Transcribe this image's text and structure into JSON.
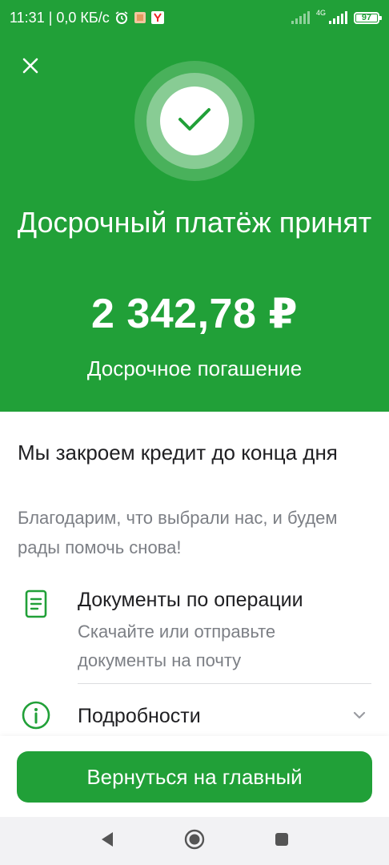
{
  "status_bar": {
    "time_speed": "11:31 | 0,0 КБ/с",
    "network": "4G",
    "battery": "97",
    "icons": [
      "alarm-icon",
      "app-notification-icon",
      "yandex-icon",
      "signal-icon",
      "battery-icon"
    ]
  },
  "hero": {
    "close_icon": "close-icon",
    "status_icon": "checkmark-icon",
    "title": "Досрочный платёж принят",
    "amount": "2 342,78 ₽",
    "subtitle": "Досрочное погашение"
  },
  "content": {
    "title": "Мы закроем кредит до конца дня",
    "text": "Благодарим, что выбрали нас, и будем рады помочь снова!"
  },
  "documents": {
    "icon": "document-icon",
    "title": "Документы по операции",
    "description": "Скачайте или отправьте документы на почту"
  },
  "details": {
    "icon": "info-icon",
    "title": "Подробности",
    "chevron": "chevron-down-icon"
  },
  "footer": {
    "button_label": "Вернуться на главный"
  },
  "nav": {
    "icons": [
      "back-icon",
      "home-icon",
      "recents-icon"
    ]
  },
  "colors": {
    "brand_green": "#21a038",
    "text_primary": "#1f1f22",
    "text_secondary": "#7c7f85"
  }
}
